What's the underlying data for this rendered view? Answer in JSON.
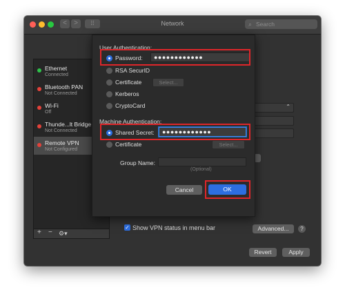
{
  "window": {
    "title": "Network",
    "search_placeholder": "Search",
    "nav_back": "<",
    "nav_forward": ">",
    "grid_icon": "⠿"
  },
  "services": [
    {
      "name": "Ethernet",
      "status": "Connected",
      "color": "#2ec24a"
    },
    {
      "name": "Bluetooth PAN",
      "status": "Not Connected",
      "color": "#e4423a"
    },
    {
      "name": "Wi-Fi",
      "status": "Off",
      "color": "#e4423a"
    },
    {
      "name": "Thunde...lt Bridge",
      "status": "Not Connected",
      "color": "#e4423a"
    },
    {
      "name": "Remote VPN",
      "status": "Not Configured",
      "color": "#e4423a"
    }
  ],
  "sidebar_tools": {
    "add": "+",
    "remove": "−",
    "gear": "⚙▾"
  },
  "main": {
    "show_vpn_status_label": "Show VPN status in menu bar",
    "advanced_label": "Advanced...",
    "help_label": "?",
    "revert_label": "Revert",
    "apply_label": "Apply"
  },
  "sheet": {
    "user_auth_title": "User Authentication:",
    "password_label": "Password:",
    "password_value": "●●●●●●●●●●●●",
    "rsa_label": "RSA SecurID",
    "certificate_label": "Certificate",
    "select_label": "Select...",
    "kerberos_label": "Kerberos",
    "cryptocard_label": "CryptoCard",
    "machine_auth_title": "Machine Authentication:",
    "shared_secret_label": "Shared Secret:",
    "shared_secret_value": "●●●●●●●●●●●●",
    "machine_certificate_label": "Certificate",
    "machine_select_label": "Select...",
    "group_name_label": "Group Name:",
    "group_name_value": "",
    "optional_hint": "(Optional)",
    "cancel_label": "Cancel",
    "ok_label": "OK"
  },
  "colors": {
    "accent": "#2d6ee0",
    "highlight": "#e0262a"
  }
}
